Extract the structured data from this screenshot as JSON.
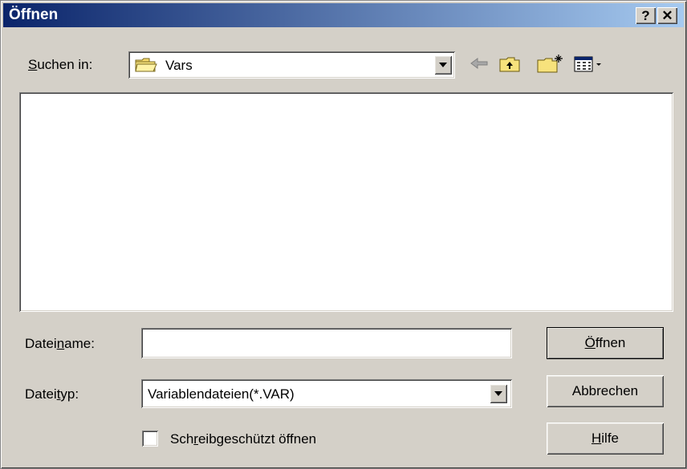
{
  "window": {
    "title": "Öffnen",
    "help_label": "?",
    "close_label": "✕"
  },
  "lookin": {
    "label_prefix": "S",
    "label_rest": "uchen in:",
    "current_folder": "Vars",
    "folder_icon": "folder-icon"
  },
  "toolbar": {
    "back": "back-arrow-icon",
    "up": "up-folder-icon",
    "new_folder": "new-folder-icon",
    "views": "view-menu-icon"
  },
  "filename": {
    "label_a": "Datei",
    "label_u": "n",
    "label_b": "ame:",
    "value": ""
  },
  "filetype": {
    "label_a": "Datei",
    "label_u": "t",
    "label_b": "yp:",
    "selected": "Variablendateien(*.VAR)"
  },
  "readonly": {
    "label_a": "Sch",
    "label_u": "r",
    "label_b": "eibgeschützt öffnen",
    "checked": false
  },
  "buttons": {
    "open": {
      "u": "Ö",
      "rest": "ffnen"
    },
    "cancel": "Abbrechen",
    "help": {
      "u": "H",
      "rest": "ilfe"
    }
  },
  "colors": {
    "titlebar_start": "#0a246a",
    "titlebar_end": "#a6caf0",
    "face": "#d4d0c8"
  }
}
